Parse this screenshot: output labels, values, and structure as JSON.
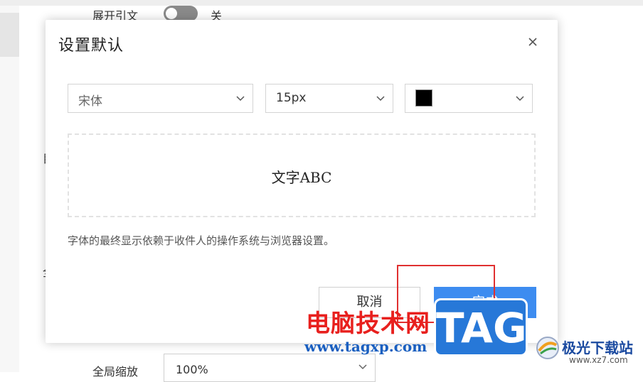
{
  "background": {
    "expand_quote_label": "展开引文",
    "expand_quote_state": "关",
    "stub_label_1": "目",
    "stub_label_2": "全",
    "zoom_label": "全局缩放",
    "zoom_value": "100%"
  },
  "dialog": {
    "title": "设置默认",
    "font_family": "宋体",
    "font_size": "15px",
    "color": "#000000",
    "preview_text": "文字ABC",
    "hint": "字体的最终显示依赖于收件人的操作系统与浏览器设置。",
    "cancel_label": "取消",
    "ok_label": "完成"
  },
  "watermark": {
    "site_cn": "电脑技术网",
    "site_url": "www.tagxp.com",
    "tag": "TAG",
    "logo_cn": "极光下载站",
    "logo_url": "www.xz7.com"
  },
  "colors": {
    "accent": "#3d8cf0",
    "highlight": "#e03030"
  },
  "icons": {
    "close": "close-icon",
    "dropdown": "chevron-down-icon"
  }
}
